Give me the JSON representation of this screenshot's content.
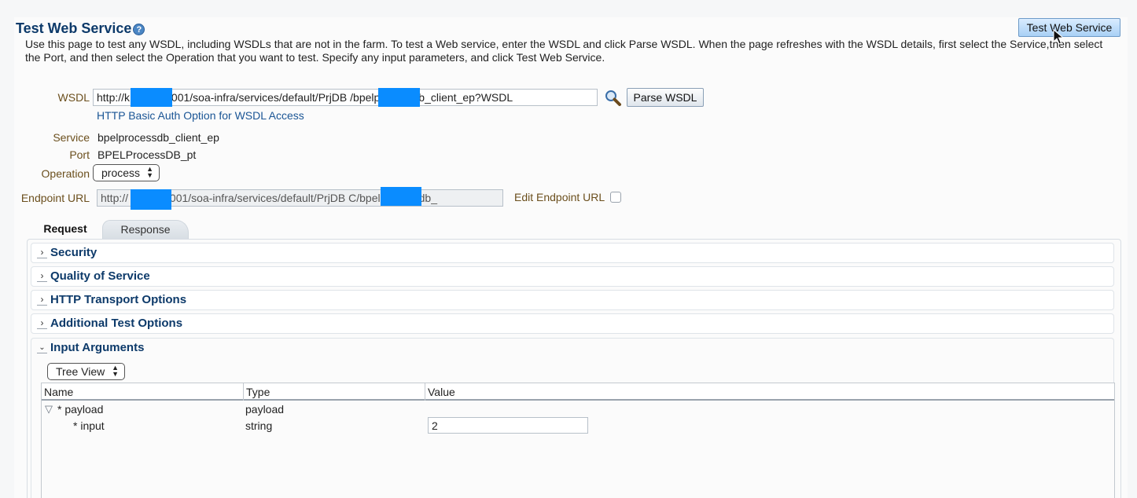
{
  "page": {
    "title": "Test Web Service",
    "help_icon": "?",
    "test_button_label": "Test Web Service",
    "description": "Use this page to test any WSDL, including WSDLs that are not in the farm. To test a Web service, enter the WSDL and click Parse WSDL. When the page refreshes with the WSDL details, first select the Service,then select the Port, and then select the Operation that you want to test. Specify any input parameters, and click Test Web Service."
  },
  "form": {
    "wsdl_label": "WSDL",
    "wsdl_value": "http://k          om.sv:8001/soa-infra/services/default/PrjDB            /bpelprocessdb_client_ep?WSDL",
    "parse_button": "Parse WSDL",
    "auth_link": "HTTP Basic Auth Option for WSDL Access",
    "service_label": "Service",
    "service_value": "bpelprocessdb_client_ep",
    "port_label": "Port",
    "port_value": "BPELProcessDB_pt",
    "operation_label": "Operation",
    "operation_value": "process",
    "endpoint_label": "Endpoint URL",
    "endpoint_value": "http://          om.sv:8001/soa-infra/services/default/PrjDB            C/bpelprocessdb_",
    "edit_endpoint_label": "Edit Endpoint URL",
    "edit_endpoint_checked": false
  },
  "tabs": [
    {
      "label": "Request",
      "active": true
    },
    {
      "label": "Response",
      "active": false
    }
  ],
  "sections": [
    {
      "title": "Security",
      "expanded": false
    },
    {
      "title": "Quality of Service",
      "expanded": false
    },
    {
      "title": "HTTP Transport Options",
      "expanded": false
    },
    {
      "title": "Additional Test Options",
      "expanded": false
    },
    {
      "title": "Input Arguments",
      "expanded": true
    }
  ],
  "input_args": {
    "view_select": "Tree View",
    "columns": [
      "Name",
      "Type",
      "Value"
    ],
    "rows": [
      {
        "name": "* payload",
        "type": "payload",
        "value": ""
      },
      {
        "name": "* input",
        "type": "string",
        "value": "2"
      }
    ]
  },
  "colors": {
    "title": "#0d3a6a",
    "label": "#6b4f1d",
    "link": "#1a5595",
    "redaction": "#0a8cff"
  },
  "icons": {
    "search": "magnifier-icon",
    "help": "help-icon",
    "cursor": "mouse-cursor-icon"
  }
}
